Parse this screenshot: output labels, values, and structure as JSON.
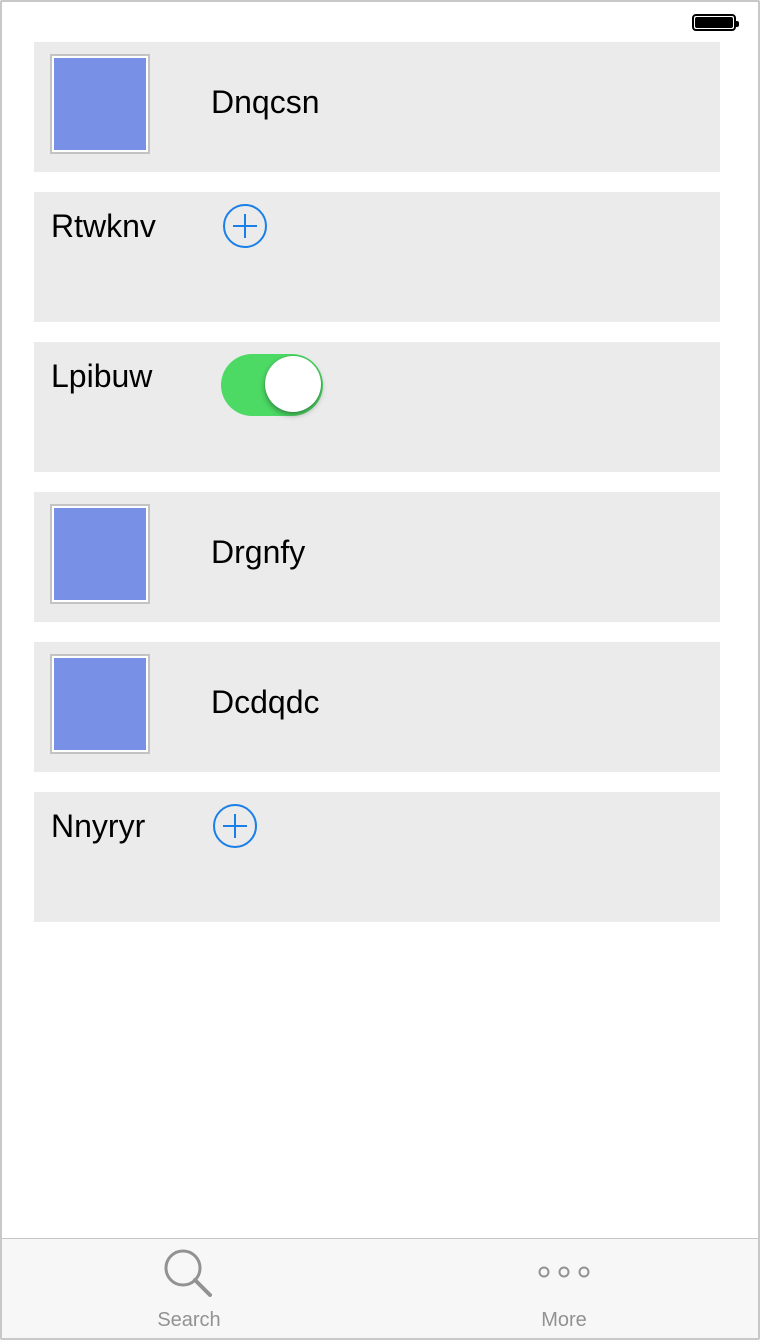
{
  "status_bar": {
    "battery_icon": "battery-icon"
  },
  "colors": {
    "row_bg": "#ebebeb",
    "thumb_fill": "#7890e6",
    "accent": "#1a7fe6",
    "toggle_on": "#4cd964"
  },
  "rows": [
    {
      "type": "image",
      "title": "Dnqcsn"
    },
    {
      "type": "add",
      "title": "Rtwknv"
    },
    {
      "type": "toggle",
      "title": "Lpibuw",
      "toggle_on": true
    },
    {
      "type": "image",
      "title": "Drgnfy"
    },
    {
      "type": "image",
      "title": "Dcdqdc"
    },
    {
      "type": "add",
      "title": "Nnyryr"
    }
  ],
  "tabbar": {
    "tabs": [
      {
        "label": "Search",
        "icon": "search-icon"
      },
      {
        "label": "More",
        "icon": "more-icon"
      }
    ]
  }
}
